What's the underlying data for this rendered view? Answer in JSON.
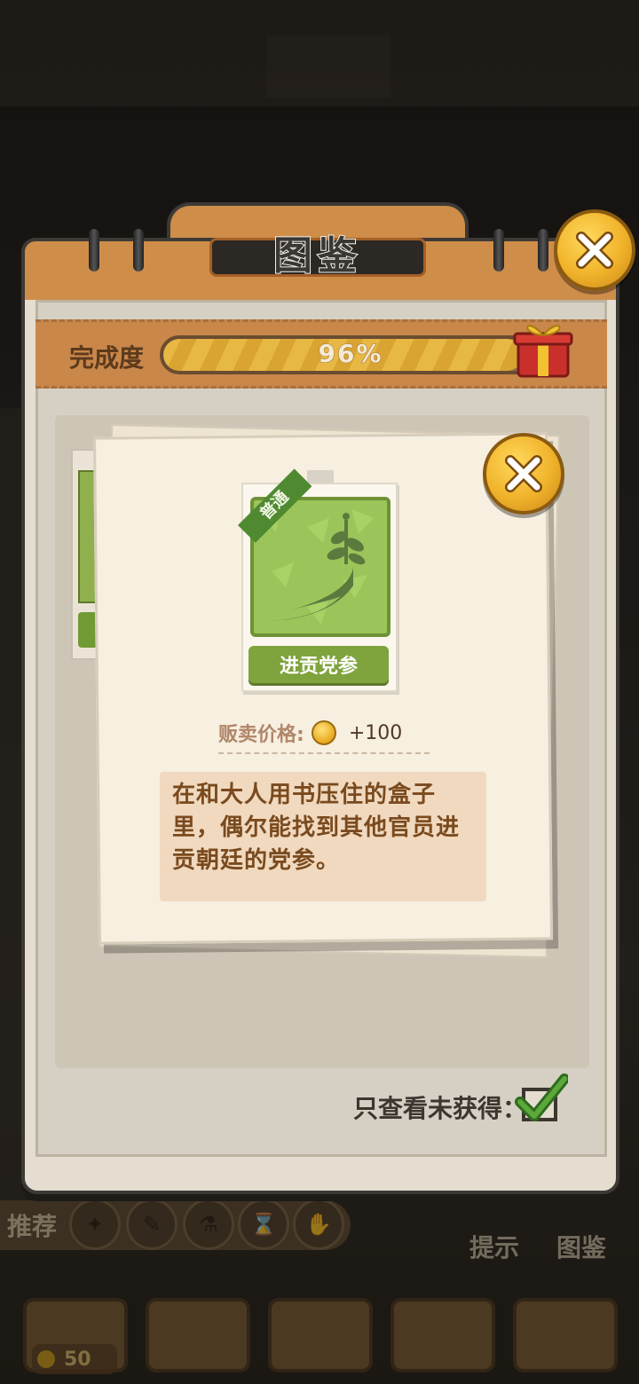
{
  "panel": {
    "title": "图鉴",
    "progress_label": "完成度",
    "progress_percent": 96,
    "progress_text": "96%",
    "filter_label": "只查看未获得：",
    "filter_checked": true
  },
  "popup": {
    "rarity": "普通",
    "item_name": "进贡党参",
    "price_label": "贩卖价格:",
    "price_value": "+100",
    "description": "在和大人用书压住的盒子里，偶尔能找到其他官员进贡朝廷的党参。"
  },
  "background_ui": {
    "recommend_label": "推荐",
    "hint_label": "提示",
    "collection_label": "图鉴",
    "coins": "50"
  },
  "colors": {
    "panel_orange": "#cf8d4a",
    "card_green": "#9bc55a",
    "close_gold": "#f0b22a",
    "desc_brown": "#7a4a1e"
  }
}
